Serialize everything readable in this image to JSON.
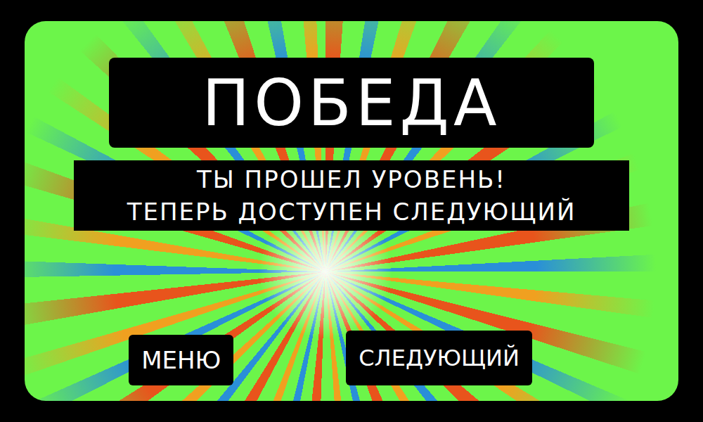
{
  "title": "ПОБЕДА",
  "message": [
    "ТЫ ПРОШЕЛ УРОВЕНЬ!",
    "ТЕПЕРЬ ДОСТУПЕН СЛЕДУЮЩИЙ"
  ],
  "buttons": [
    {
      "label": "МЕНЮ"
    },
    {
      "label": "СЛЕДУЮЩИЙ"
    }
  ]
}
